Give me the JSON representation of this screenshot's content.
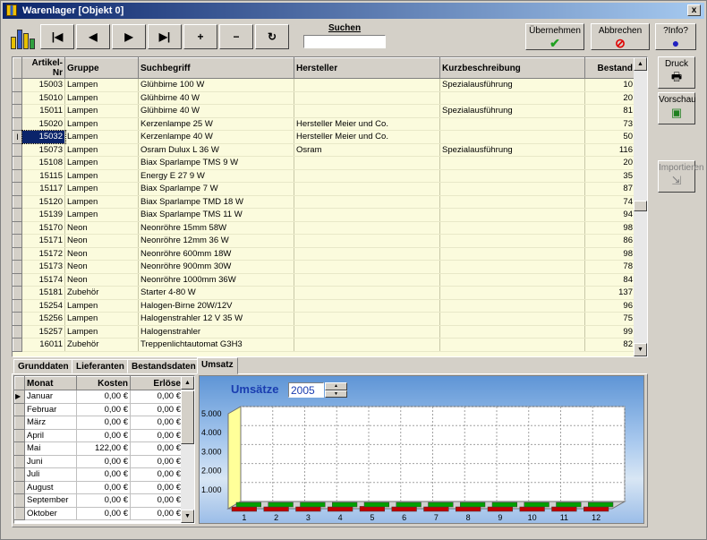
{
  "window": {
    "title": "Warenlager [Objekt 0]",
    "close_label": "x"
  },
  "toolbar": {
    "first": "|◀",
    "prev": "◀",
    "next": "▶",
    "last": "▶|",
    "add": "+",
    "remove": "−",
    "refresh": "↻",
    "search_label": "Suchen",
    "search_value": "",
    "apply_label": "Übernehmen",
    "cancel_label": "Abbrechen",
    "info_label": "?Info?"
  },
  "side": {
    "print_label": "Druck",
    "preview_label": "Vorschau",
    "import_label": "Importieren"
  },
  "table": {
    "columns": [
      "Artikel-Nr",
      "Gruppe",
      "Suchbegriff",
      "Hersteller",
      "Kurzbeschreibung",
      "Bestand"
    ],
    "selected_index": 4,
    "rows": [
      [
        "15003",
        "Lampen",
        "Glühbirne 100 W",
        "",
        "Spezialausführung",
        "10"
      ],
      [
        "15010",
        "Lampen",
        "Glühbirne 40 W",
        "",
        "",
        "20"
      ],
      [
        "15011",
        "Lampen",
        "Glühbirne 40 W",
        "",
        "Spezialausführung",
        "81"
      ],
      [
        "15020",
        "Lampen",
        "Kerzenlampe 25 W",
        "Hersteller Meier und Co.",
        "",
        "73"
      ],
      [
        "15032",
        "Lampen",
        "Kerzenlampe 40 W",
        "Hersteller Meier und Co.",
        "",
        "50"
      ],
      [
        "15073",
        "Lampen",
        "Osram Dulux L 36 W",
        "Osram",
        "Spezialausführung",
        "116"
      ],
      [
        "15108",
        "Lampen",
        "Biax Sparlampe TMS 9 W",
        "",
        "",
        "20"
      ],
      [
        "15115",
        "Lampen",
        "Energy E 27 9 W",
        "",
        "",
        "35"
      ],
      [
        "15117",
        "Lampen",
        "Biax Sparlampe 7 W",
        "",
        "",
        "87"
      ],
      [
        "15120",
        "Lampen",
        "Biax Sparlampe TMD 18 W",
        "",
        "",
        "74"
      ],
      [
        "15139",
        "Lampen",
        "Biax Sparlampe TMS 11 W",
        "",
        "",
        "94"
      ],
      [
        "15170",
        "Neon",
        "Neonröhre 15mm  58W",
        "",
        "",
        "98"
      ],
      [
        "15171",
        "Neon",
        "Neonröhre 12mm 36 W",
        "",
        "",
        "86"
      ],
      [
        "15172",
        "Neon",
        "Neonröhre 600mm 18W",
        "",
        "",
        "98"
      ],
      [
        "15173",
        "Neon",
        "Neonröhre 900mm 30W",
        "",
        "",
        "78"
      ],
      [
        "15174",
        "Neon",
        "Neonröhre 1000mm 36W",
        "",
        "",
        "84"
      ],
      [
        "15181",
        "Zubehör",
        "Starter 4-80 W",
        "",
        "",
        "137"
      ],
      [
        "15254",
        "Lampen",
        "Halogen-Birne 20W/12V",
        "",
        "",
        "96"
      ],
      [
        "15256",
        "Lampen",
        "Halogenstrahler 12 V  35 W",
        "",
        "",
        "75"
      ],
      [
        "15257",
        "Lampen",
        "Halogenstrahler",
        "",
        "",
        "99"
      ],
      [
        "16011",
        "Zubehör",
        "Treppenlichtautomat G3H3",
        "",
        "",
        "82"
      ]
    ]
  },
  "tabs": [
    "Grunddaten",
    "Lieferanten",
    "Bestandsdaten",
    "Umsatz"
  ],
  "active_tab": "Umsatz",
  "months_table": {
    "columns": [
      "Monat",
      "Kosten",
      "Erlöse"
    ],
    "rows": [
      [
        "Januar",
        "0,00 €",
        "0,00 €"
      ],
      [
        "Februar",
        "0,00 €",
        "0,00 €"
      ],
      [
        "März",
        "0,00 €",
        "0,00 €"
      ],
      [
        "April",
        "0,00 €",
        "0,00 €"
      ],
      [
        "Mai",
        "122,00 €",
        "0,00 €"
      ],
      [
        "Juni",
        "0,00 €",
        "0,00 €"
      ],
      [
        "Juli",
        "0,00 €",
        "0,00 €"
      ],
      [
        "August",
        "0,00 €",
        "0,00 €"
      ],
      [
        "September",
        "0,00 €",
        "0,00 €"
      ],
      [
        "Oktober",
        "0,00 €",
        "0,00 €"
      ]
    ]
  },
  "chart_data": {
    "type": "bar",
    "title": "Umsätze",
    "year": "2005",
    "categories": [
      "1",
      "2",
      "3",
      "4",
      "5",
      "6",
      "7",
      "8",
      "9",
      "10",
      "11",
      "12"
    ],
    "series": [
      {
        "values": [
          0,
          0,
          0,
          0,
          122,
          0,
          0,
          0,
          0,
          0,
          0,
          0
        ]
      },
      {
        "values": [
          0,
          0,
          0,
          0,
          0,
          0,
          0,
          0,
          0,
          0,
          0,
          0
        ]
      }
    ],
    "y_ticks": [
      "1.000",
      "2.000",
      "3.000",
      "4.000",
      "5.000"
    ],
    "ylim": [
      0,
      5000
    ],
    "colors": [
      "#c00000",
      "#00a000"
    ],
    "grid": true
  }
}
